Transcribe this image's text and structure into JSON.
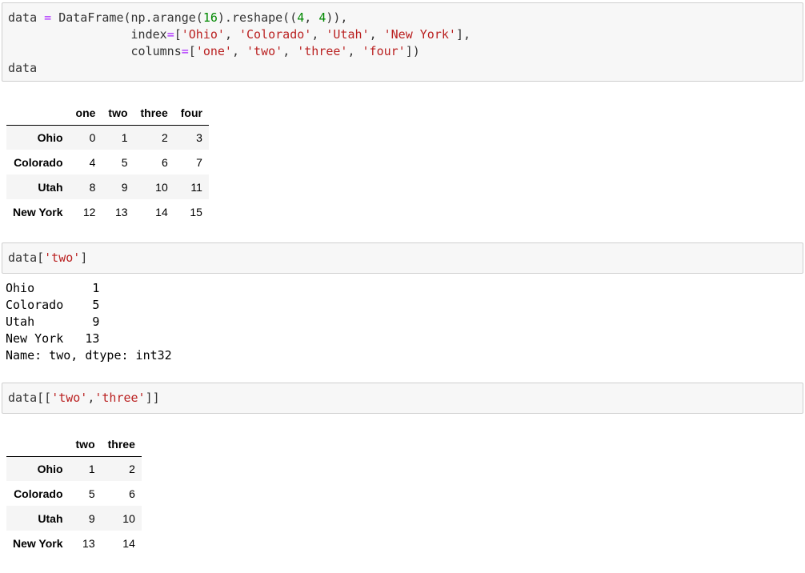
{
  "cell1": {
    "lines": [
      [
        {
          "t": "data ",
          "c": "plain"
        },
        {
          "t": "=",
          "c": "op"
        },
        {
          "t": " DataFrame(np.arange(",
          "c": "plain"
        },
        {
          "t": "16",
          "c": "num"
        },
        {
          "t": ").reshape((",
          "c": "plain"
        },
        {
          "t": "4",
          "c": "num"
        },
        {
          "t": ", ",
          "c": "plain"
        },
        {
          "t": "4",
          "c": "num"
        },
        {
          "t": ")),",
          "c": "plain"
        }
      ],
      [
        {
          "t": "                 index",
          "c": "plain"
        },
        {
          "t": "=",
          "c": "op"
        },
        {
          "t": "[",
          "c": "plain"
        },
        {
          "t": "'Ohio'",
          "c": "str"
        },
        {
          "t": ", ",
          "c": "plain"
        },
        {
          "t": "'Colorado'",
          "c": "str"
        },
        {
          "t": ", ",
          "c": "plain"
        },
        {
          "t": "'Utah'",
          "c": "str"
        },
        {
          "t": ", ",
          "c": "plain"
        },
        {
          "t": "'New York'",
          "c": "str"
        },
        {
          "t": "],",
          "c": "plain"
        }
      ],
      [
        {
          "t": "                 columns",
          "c": "plain"
        },
        {
          "t": "=",
          "c": "op"
        },
        {
          "t": "[",
          "c": "plain"
        },
        {
          "t": "'one'",
          "c": "str"
        },
        {
          "t": ", ",
          "c": "plain"
        },
        {
          "t": "'two'",
          "c": "str"
        },
        {
          "t": ", ",
          "c": "plain"
        },
        {
          "t": "'three'",
          "c": "str"
        },
        {
          "t": ", ",
          "c": "plain"
        },
        {
          "t": "'four'",
          "c": "str"
        },
        {
          "t": "])",
          "c": "plain"
        }
      ],
      [
        {
          "t": "data",
          "c": "plain"
        }
      ]
    ]
  },
  "table1": {
    "columns": [
      "",
      "one",
      "two",
      "three",
      "four"
    ],
    "rows": [
      {
        "index": "Ohio",
        "values": [
          "0",
          "1",
          "2",
          "3"
        ]
      },
      {
        "index": "Colorado",
        "values": [
          "4",
          "5",
          "6",
          "7"
        ]
      },
      {
        "index": "Utah",
        "values": [
          "8",
          "9",
          "10",
          "11"
        ]
      },
      {
        "index": "New York",
        "values": [
          "12",
          "13",
          "14",
          "15"
        ]
      }
    ]
  },
  "cell2": {
    "lines": [
      [
        {
          "t": "data[",
          "c": "plain"
        },
        {
          "t": "'two'",
          "c": "str"
        },
        {
          "t": "]",
          "c": "plain"
        }
      ]
    ]
  },
  "output2": {
    "lines": [
      "Ohio        1",
      "Colorado    5",
      "Utah        9",
      "New York   13",
      "Name: two, dtype: int32"
    ]
  },
  "cell3": {
    "lines": [
      [
        {
          "t": "data[[",
          "c": "plain"
        },
        {
          "t": "'two'",
          "c": "str"
        },
        {
          "t": ",",
          "c": "plain"
        },
        {
          "t": "'three'",
          "c": "str"
        },
        {
          "t": "]]",
          "c": "plain"
        }
      ]
    ]
  },
  "table2": {
    "columns": [
      "",
      "two",
      "three"
    ],
    "rows": [
      {
        "index": "Ohio",
        "values": [
          "1",
          "2"
        ]
      },
      {
        "index": "Colorado",
        "values": [
          "5",
          "6"
        ]
      },
      {
        "index": "Utah",
        "values": [
          "9",
          "10"
        ]
      },
      {
        "index": "New York",
        "values": [
          "13",
          "14"
        ]
      }
    ]
  }
}
